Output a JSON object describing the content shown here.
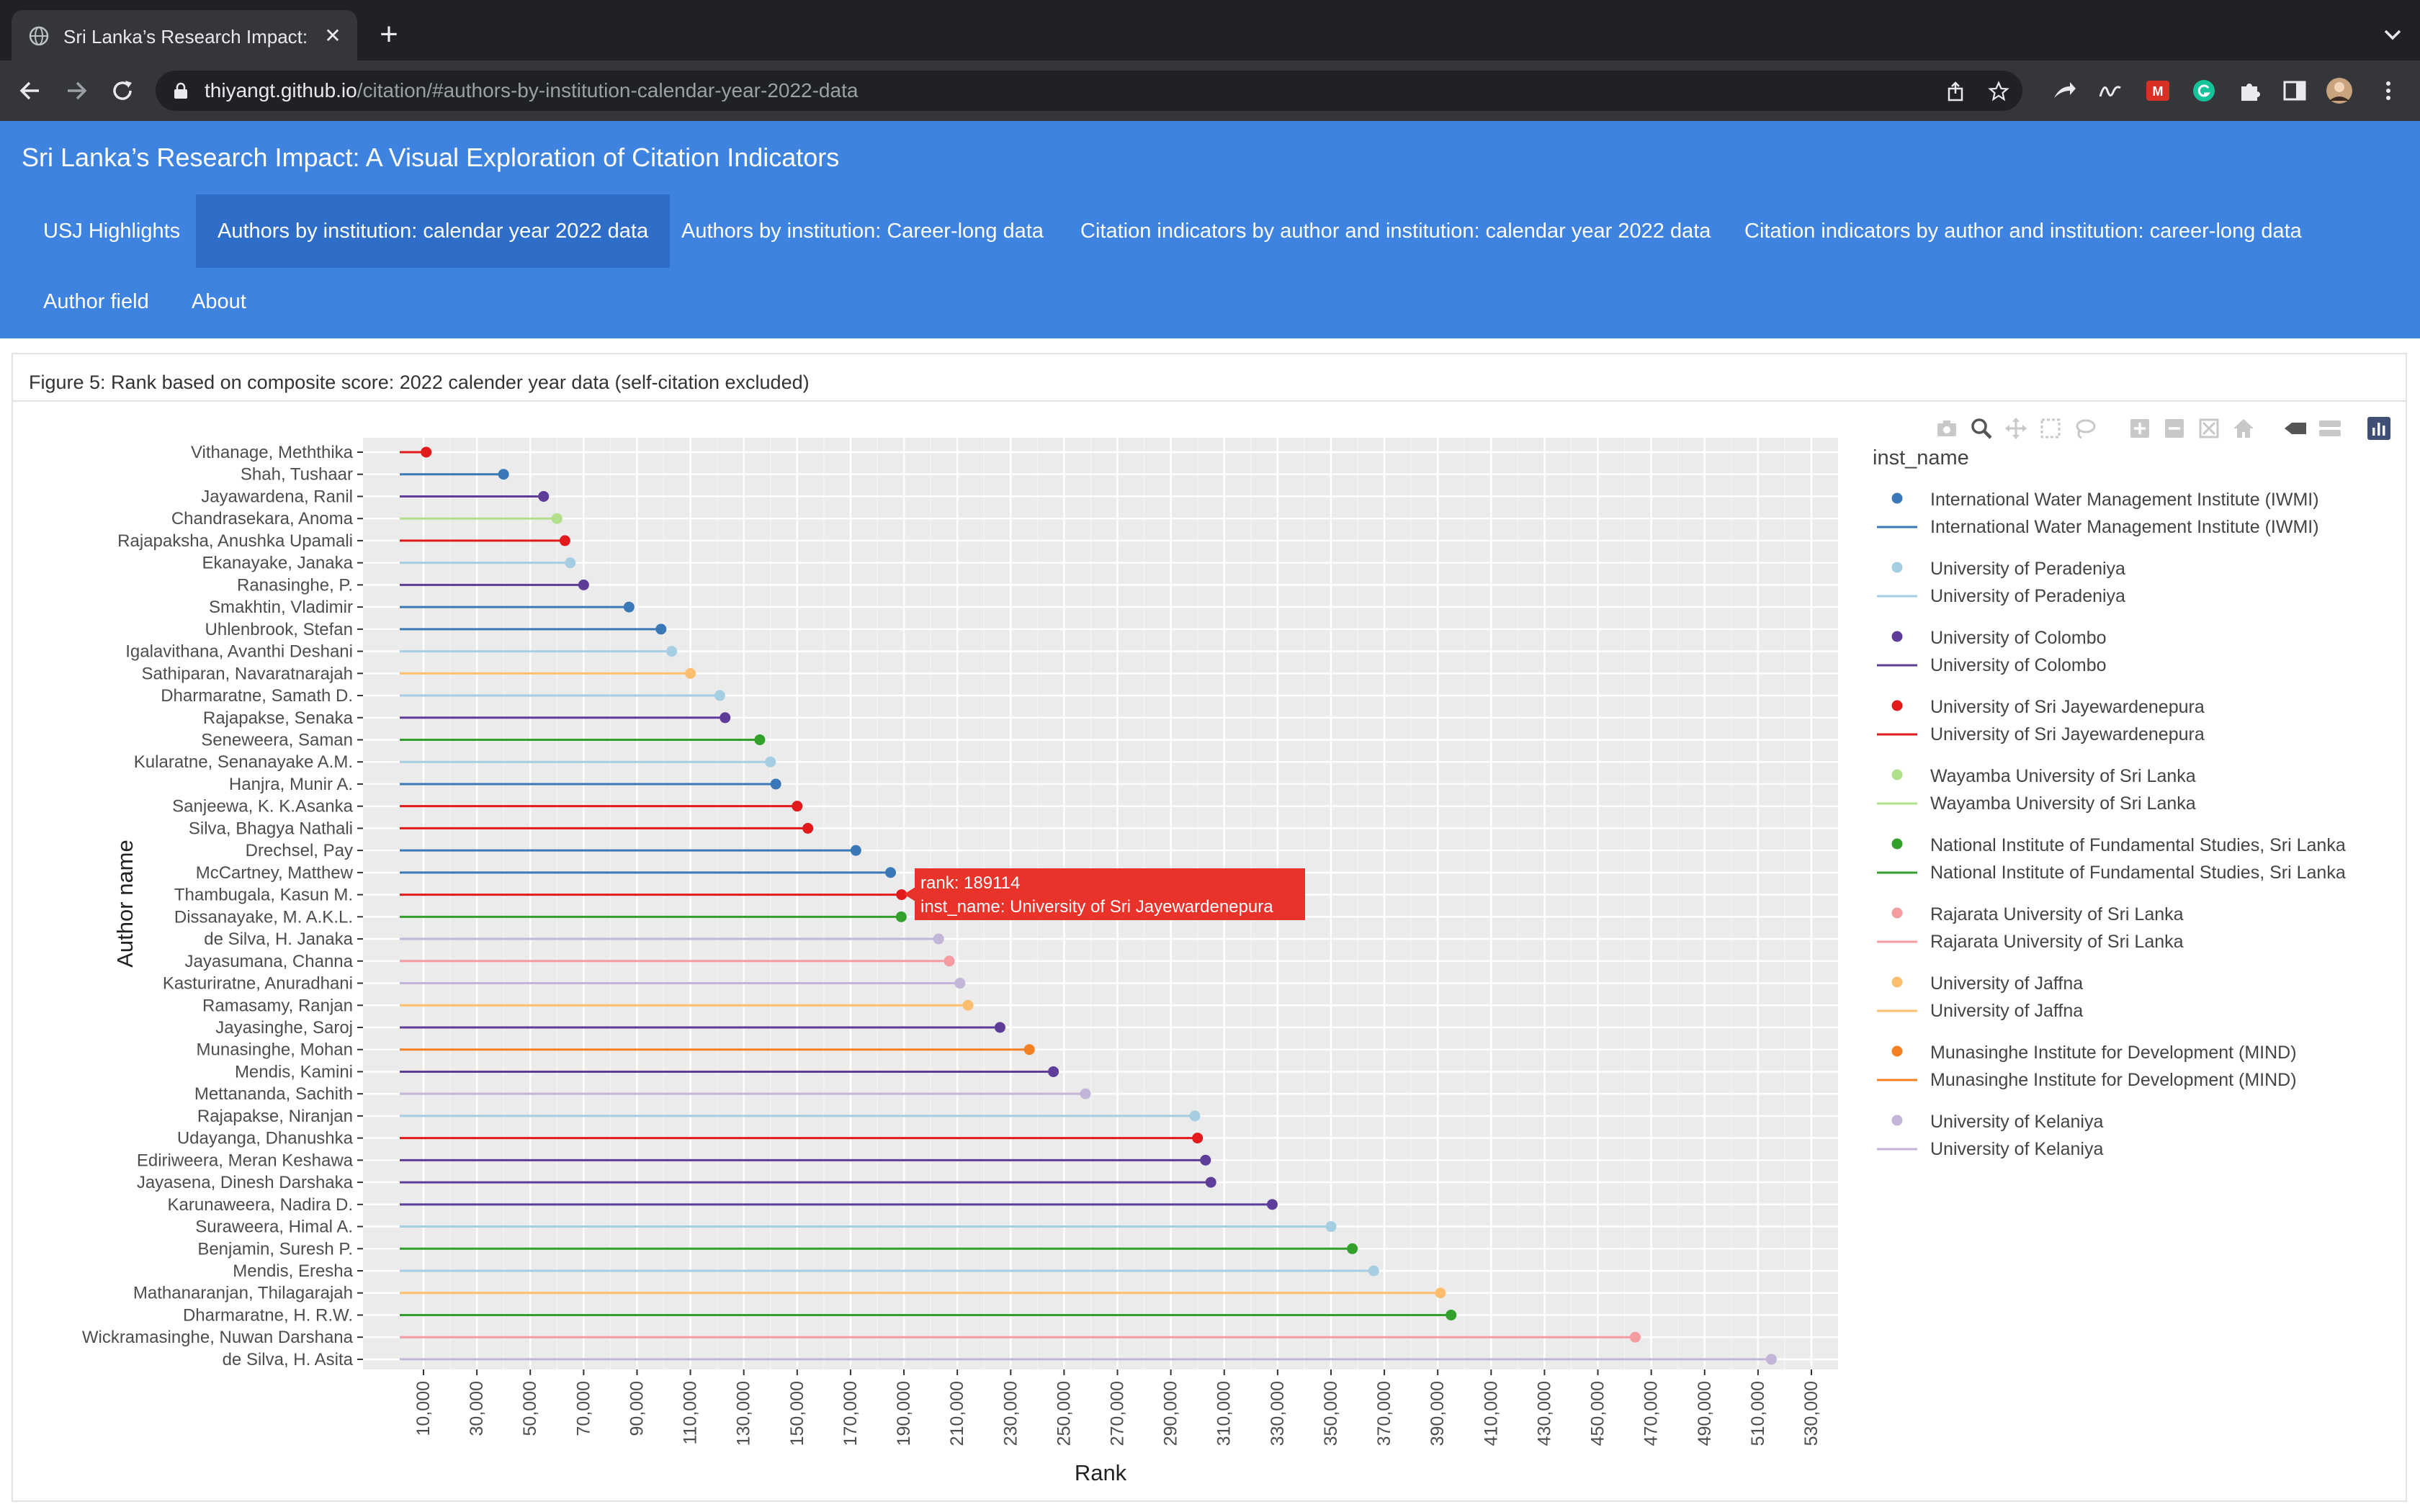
{
  "browser": {
    "tab_title": "Sri Lanka’s Research Impact: A Visual Exploration of Citation Indicators",
    "url_host": "thiyangt.github.io",
    "url_path": "/citation/#authors-by-institution-calendar-year-2022-data"
  },
  "site": {
    "title": "Sri Lanka’s Research Impact: A Visual Exploration of Citation Indicators",
    "nav": [
      {
        "label": "USJ Highlights"
      },
      {
        "label": "Authors by institution: calendar year 2022 data"
      },
      {
        "label": "Authors by institution: Career-long data"
      },
      {
        "label": "Citation indicators by author and institution: calendar year 2022 data"
      },
      {
        "label": "Citation indicators by author and institution: career-long data"
      },
      {
        "label": "Author field"
      },
      {
        "label": "About"
      }
    ]
  },
  "figure": {
    "caption": "Figure 5: Rank based on composite score: 2022 calender year data (self-citation excluded)"
  },
  "modebar_icons": [
    "camera-icon",
    "zoom-icon",
    "pan-icon",
    "box-select-icon",
    "lasso-select-icon",
    "zoom-in-icon",
    "zoom-out-icon",
    "autoscale-icon",
    "reset-axes-icon",
    "spike-lines-icon",
    "compare-hover-icon",
    "plotly-logo-icon"
  ],
  "tooltip": {
    "line1": "rank: 189114",
    "line2": "inst_name: University of Sri Jayewardenepura"
  },
  "chart_data": {
    "type": "scatter",
    "subtype": "lollipop",
    "xlabel": "Rank",
    "ylabel": "Author name",
    "xlim": [
      0,
      530000
    ],
    "x_ticks": [
      10000,
      30000,
      50000,
      70000,
      90000,
      110000,
      130000,
      150000,
      170000,
      190000,
      210000,
      230000,
      250000,
      270000,
      290000,
      310000,
      330000,
      350000,
      370000,
      390000,
      410000,
      430000,
      450000,
      470000,
      490000,
      510000,
      530000
    ],
    "x_tick_labels": [
      "10,000",
      "30,000",
      "50,000",
      "70,000",
      "90,000",
      "110,000",
      "130,000",
      "150,000",
      "170,000",
      "190,000",
      "210,000",
      "230,000",
      "250,000",
      "270,000",
      "290,000",
      "310,000",
      "330,000",
      "350,000",
      "370,000",
      "390,000",
      "410,000",
      "430,000",
      "450,000",
      "470,000",
      "490,000",
      "510,000",
      "530,000"
    ],
    "grid": true,
    "legend_title": "inst_name",
    "legend_position": "right",
    "institutions": [
      {
        "name": "International Water Management Institute (IWMI)",
        "color": "#3a78b8"
      },
      {
        "name": "University of Peradeniya",
        "color": "#a6cee3"
      },
      {
        "name": "University of Colombo",
        "color": "#5e3c99"
      },
      {
        "name": "University of Sri Jayewardenepura",
        "color": "#e31a1c"
      },
      {
        "name": "Wayamba University of Sri Lanka",
        "color": "#b2df8a"
      },
      {
        "name": "National Institute of Fundamental Studies, Sri Lanka",
        "color": "#33a02c"
      },
      {
        "name": "Rajarata University of Sri Lanka",
        "color": "#f49ca0"
      },
      {
        "name": "University of Jaffna",
        "color": "#fdbf6f"
      },
      {
        "name": "Munasinghe Institute for Development (MIND)",
        "color": "#f48024"
      },
      {
        "name": "University of Kelaniya",
        "color": "#c2b5d8"
      }
    ],
    "points": [
      {
        "author": "Vithanage, Meththika",
        "rank": 11000,
        "inst": 3
      },
      {
        "author": "Shah, Tushaar",
        "rank": 40000,
        "inst": 0
      },
      {
        "author": "Jayawardena, Ranil",
        "rank": 55000,
        "inst": 2
      },
      {
        "author": "Chandrasekara, Anoma",
        "rank": 60000,
        "inst": 4
      },
      {
        "author": "Rajapaksha, Anushka Upamali",
        "rank": 63000,
        "inst": 3
      },
      {
        "author": "Ekanayake, Janaka",
        "rank": 65000,
        "inst": 1
      },
      {
        "author": "Ranasinghe, P.",
        "rank": 70000,
        "inst": 2
      },
      {
        "author": "Smakhtin, Vladimir",
        "rank": 87000,
        "inst": 0
      },
      {
        "author": "Uhlenbrook, Stefan",
        "rank": 99000,
        "inst": 0
      },
      {
        "author": "Igalavithana, Avanthi Deshani",
        "rank": 103000,
        "inst": 1
      },
      {
        "author": "Sathiparan, Navaratnarajah",
        "rank": 110000,
        "inst": 7
      },
      {
        "author": "Dharmaratne, Samath D.",
        "rank": 121000,
        "inst": 1
      },
      {
        "author": "Rajapakse, Senaka",
        "rank": 123000,
        "inst": 2
      },
      {
        "author": "Seneweera, Saman",
        "rank": 136000,
        "inst": 5
      },
      {
        "author": "Kularatne, Senanayake A.M.",
        "rank": 140000,
        "inst": 1
      },
      {
        "author": "Hanjra, Munir A.",
        "rank": 142000,
        "inst": 0
      },
      {
        "author": "Sanjeewa, K. K.Asanka",
        "rank": 150000,
        "inst": 3
      },
      {
        "author": "Silva, Bhagya Nathali",
        "rank": 154000,
        "inst": 3
      },
      {
        "author": "Drechsel, Pay",
        "rank": 172000,
        "inst": 0
      },
      {
        "author": "McCartney, Matthew",
        "rank": 185000,
        "inst": 0
      },
      {
        "author": "Thambugala, Kasun M.",
        "rank": 189114,
        "inst": 3
      },
      {
        "author": "Dissanayake, M. A.K.L.",
        "rank": 189000,
        "inst": 5
      },
      {
        "author": "de Silva, H. Janaka",
        "rank": 203000,
        "inst": 9
      },
      {
        "author": "Jayasumana, Channa",
        "rank": 207000,
        "inst": 6
      },
      {
        "author": "Kasturiratne, Anuradhani",
        "rank": 211000,
        "inst": 9
      },
      {
        "author": "Ramasamy, Ranjan",
        "rank": 214000,
        "inst": 7
      },
      {
        "author": "Jayasinghe, Saroj",
        "rank": 226000,
        "inst": 2
      },
      {
        "author": "Munasinghe, Mohan",
        "rank": 237000,
        "inst": 8
      },
      {
        "author": "Mendis, Kamini",
        "rank": 246000,
        "inst": 2
      },
      {
        "author": "Mettananda, Sachith",
        "rank": 258000,
        "inst": 9
      },
      {
        "author": "Rajapakse, Niranjan",
        "rank": 299000,
        "inst": 1
      },
      {
        "author": "Udayanga, Dhanushka",
        "rank": 300000,
        "inst": 3
      },
      {
        "author": "Ediriweera, Meran Keshawa",
        "rank": 303000,
        "inst": 2
      },
      {
        "author": "Jayasena, Dinesh Darshaka",
        "rank": 305000,
        "inst": 2
      },
      {
        "author": "Karunaweera, Nadira D.",
        "rank": 328000,
        "inst": 2
      },
      {
        "author": "Suraweera, Himal A.",
        "rank": 350000,
        "inst": 1
      },
      {
        "author": "Benjamin, Suresh P.",
        "rank": 358000,
        "inst": 5
      },
      {
        "author": "Mendis, Eresha",
        "rank": 366000,
        "inst": 1
      },
      {
        "author": "Mathanaranjan, Thilagarajah",
        "rank": 391000,
        "inst": 7
      },
      {
        "author": "Dharmaratne, H. R.W.",
        "rank": 395000,
        "inst": 5
      },
      {
        "author": "Wickramasinghe, Nuwan Darshana",
        "rank": 464000,
        "inst": 6
      },
      {
        "author": "de Silva, H. Asita",
        "rank": 515000,
        "inst": 9
      }
    ]
  }
}
